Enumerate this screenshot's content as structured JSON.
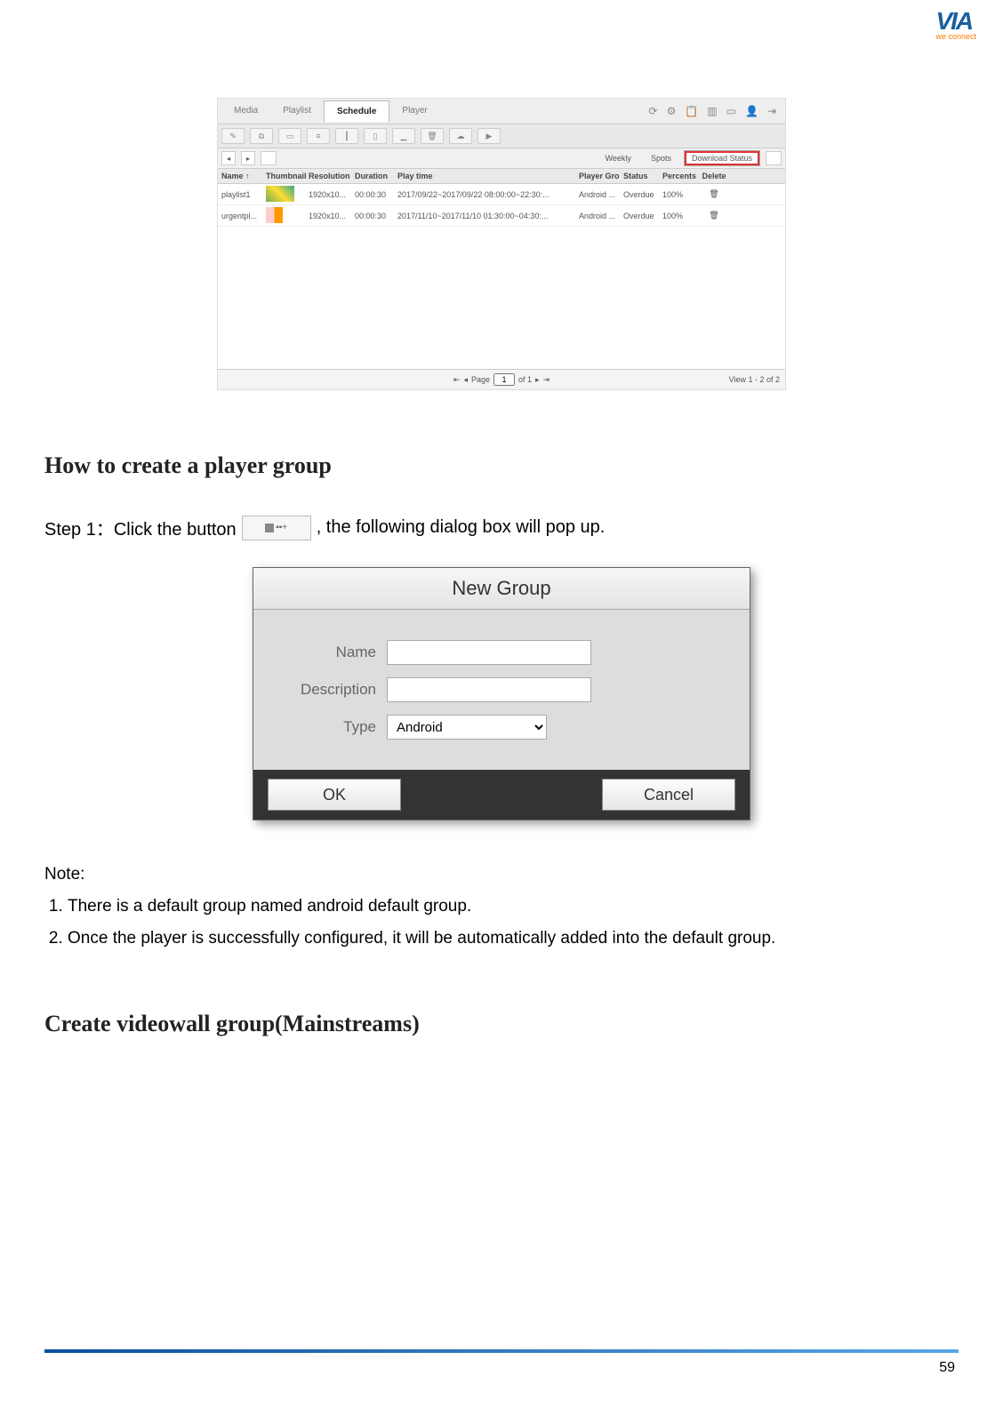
{
  "logo": {
    "brand": "VIA",
    "tagline": "we connect"
  },
  "app": {
    "tabs": {
      "media": "Media",
      "playlist": "Playlist",
      "schedule": "Schedule",
      "player": "Player"
    },
    "filter": {
      "weekly": "Weekly",
      "spots": "Spots",
      "download_status": "Download Status"
    },
    "columns": {
      "name": "Name ↑",
      "thumb": "Thumbnail",
      "res": "Resolution",
      "dur": "Duration",
      "play": "Play time",
      "grp": "Player Gro",
      "stat": "Status",
      "pct": "Percents",
      "del": "Delete"
    },
    "rows": [
      {
        "name": "playlist1",
        "res": "1920x10...",
        "dur": "00:00:30",
        "play": "2017/09/22~2017/09/22 08:00:00~22:30:...",
        "grp": "Android ...",
        "stat": "Overdue",
        "pct": "100%"
      },
      {
        "name": "urgentpl...",
        "res": "1920x10...",
        "dur": "00:00:30",
        "play": "2017/11/10~2017/11/10 01:30:00~04:30:...",
        "grp": "Android ...",
        "stat": "Overdue",
        "pct": "100%"
      }
    ],
    "pager": {
      "page_label": "Page",
      "page_value": "1",
      "of": "of 1",
      "view": "View 1 - 2 of 2"
    }
  },
  "section1_title": "How to create a player group",
  "step1_pre": "Step 1：Click the button",
  "step1_post": ", the following dialog box will pop up.",
  "dialog": {
    "title": "New Group",
    "name_label": "Name",
    "desc_label": "Description",
    "type_label": "Type",
    "type_value": "Android",
    "ok": "OK",
    "cancel": "Cancel"
  },
  "note_label": "Note:",
  "notes": {
    "n1": "There is a default group named android default group.",
    "n2": "Once the player is successfully configured, it will be automatically added into the default group."
  },
  "section2_title": "Create videowall group(Mainstreams)",
  "page_number": "59"
}
